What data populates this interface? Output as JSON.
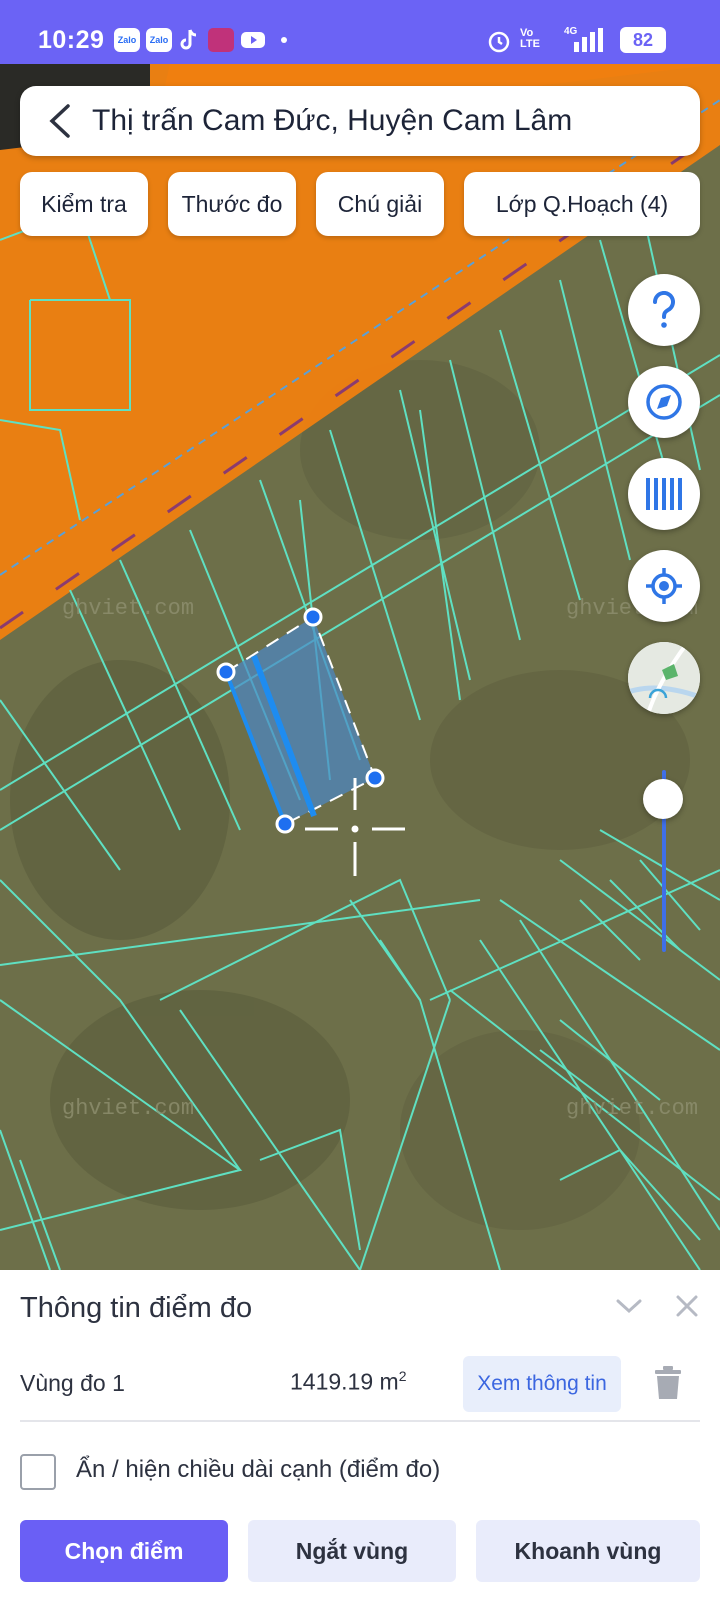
{
  "status_bar": {
    "time": "10:29",
    "notification_icons": [
      "Zalo",
      "Zalo",
      "tiktok-icon",
      "game-icon",
      "youtube-icon"
    ],
    "network": "Vo LTE",
    "signal_label": "4G",
    "battery": "82"
  },
  "header": {
    "location_title": "Thị trấn Cam Đức, Huyện Cam Lâm"
  },
  "toolbar": {
    "check_label": "Kiểm tra",
    "ruler_label": "Thước đo",
    "legend_label": "Chú giải",
    "layers_label": "Lớp Q.Hoạch (4)"
  },
  "map": {
    "watermarks": [
      "ghviet.com",
      "ghviet.com",
      "ghviet.com",
      "ghviet.com"
    ],
    "zoom_level": 0.85,
    "colors": {
      "planning_zone": "#f27f10",
      "parcel_lines": "#5fe0c2",
      "measure_fill": "#4b87c8",
      "accent": "#6a5ff5"
    }
  },
  "panel": {
    "title": "Thông tin điểm đo",
    "area_label": "Vùng đo 1",
    "area_value": "1419.19 m",
    "area_unit_exp": "2",
    "view_info_label": "Xem thông tin",
    "toggle_label": "Ẩn / hiện chiều dài cạnh (điểm đo)",
    "toggle_checked": false,
    "buttons": {
      "select_point": "Chọn điểm",
      "break_area": "Ngắt vùng",
      "enclose_area": "Khoanh vùng"
    }
  }
}
